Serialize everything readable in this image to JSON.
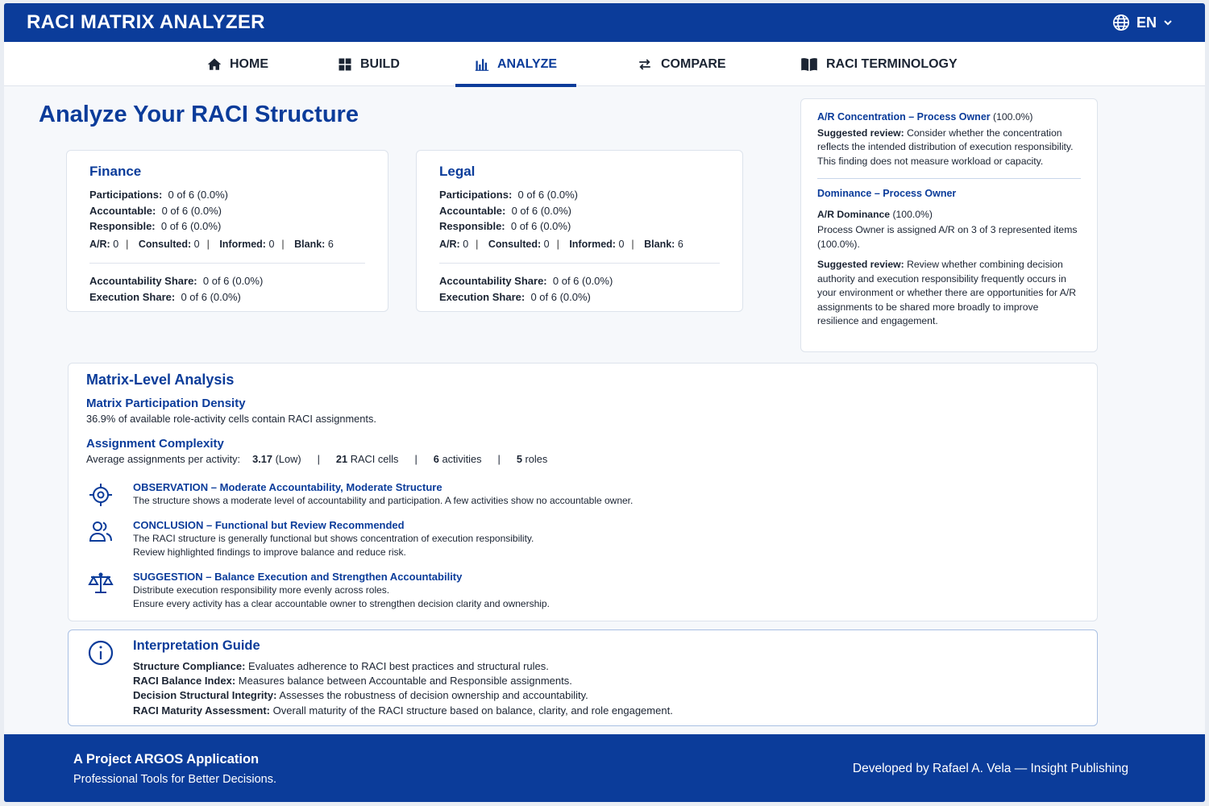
{
  "header": {
    "title": "RACI MATRIX ANALYZER",
    "language": "EN"
  },
  "nav": {
    "items": [
      {
        "label": "HOME",
        "icon": "home-icon"
      },
      {
        "label": "BUILD",
        "icon": "grid-icon"
      },
      {
        "label": "ANALYZE",
        "icon": "bar-chart-icon",
        "active": true
      },
      {
        "label": "COMPARE",
        "icon": "swap-arrows-icon"
      },
      {
        "label": "RACI TERMINOLOGY",
        "icon": "book-icon"
      }
    ]
  },
  "page": {
    "title": "Analyze Your RACI Structure"
  },
  "departments": [
    {
      "name": "Finance",
      "participations_label": "Participations:",
      "participations": "0 of 6 (0.0%)",
      "accountable_label": "Accountable:",
      "accountable": "0 of 6 (0.0%)",
      "responsible_label": "Responsible:",
      "responsible": "0 of 6 (0.0%)",
      "ar_label": "A/R:",
      "ar": "0",
      "consulted_label": "Consulted:",
      "consulted": "0",
      "informed_label": "Informed:",
      "informed": "0",
      "blank_label": "Blank:",
      "blank": "6",
      "acc_share_label": "Accountability Share:",
      "acc_share": "0 of 6 (0.0%)",
      "exec_share_label": "Execution Share:",
      "exec_share": "0 of 6 (0.0%)"
    },
    {
      "name": "Legal",
      "participations_label": "Participations:",
      "participations": "0 of 6 (0.0%)",
      "accountable_label": "Accountable:",
      "accountable": "0 of 6 (0.0%)",
      "responsible_label": "Responsible:",
      "responsible": "0 of 6 (0.0%)",
      "ar_label": "A/R:",
      "ar": "0",
      "consulted_label": "Consulted:",
      "consulted": "0",
      "informed_label": "Informed:",
      "informed": "0",
      "blank_label": "Blank:",
      "blank": "6",
      "acc_share_label": "Accountability Share:",
      "acc_share": "0 of 6 (0.0%)",
      "exec_share_label": "Execution Share:",
      "exec_share": "0 of 6 (0.0%)"
    }
  ],
  "side_panel": {
    "ar_concentration": {
      "heading": "A/R Concentration – Process Owner",
      "value": " (100.0%)",
      "review_label": "Suggested review:",
      "review_text": " Consider whether the concentration reflects the intended distribution of execution responsibility. This finding does not measure workload or capacity."
    },
    "dominance": {
      "heading": "Dominance – Process Owner",
      "ar_label": "A/R Dominance",
      "ar_value": " (100.0%)",
      "detail": "Process Owner is assigned A/R on 3 of 3 represented items (100.0%).",
      "review_label": "Suggested review:",
      "review_text": " Review whether combining decision authority and execution responsibility frequently occurs in your environment or whether there are opportunities for A/R assignments to be shared more broadly to improve resilience and engagement."
    }
  },
  "matrix": {
    "title": "Matrix-Level Analysis",
    "density_title": "Matrix Participation Density",
    "density_text": "36.9% of available role-activity cells contain RACI assignments.",
    "complexity_title": "Assignment Complexity",
    "complexity_label": "Average assignments per activity:",
    "avg_value": "3.17",
    "avg_level": " (Low)",
    "cells_value": "21",
    "cells_label": " RACI cells",
    "activities_value": "6",
    "activities_label": " activities",
    "roles_value": "5",
    "roles_label": " roles",
    "findings": [
      {
        "icon": "target-icon",
        "title": "OBSERVATION – Moderate Accountability, Moderate Structure",
        "lines": [
          "The structure shows a moderate level of accountability and participation. A few activities show no accountable owner."
        ]
      },
      {
        "icon": "users-icon",
        "title": "CONCLUSION – Functional but Review Recommended",
        "lines": [
          "The RACI structure is generally functional but shows concentration of execution responsibility.",
          "Review highlighted findings to improve balance and reduce risk."
        ]
      },
      {
        "icon": "scale-icon",
        "title": "SUGGESTION – Balance Execution and Strengthen Accountability",
        "lines": [
          "Distribute execution responsibility more evenly across roles.",
          "Ensure every activity has a clear accountable owner to strengthen decision clarity and ownership."
        ]
      }
    ]
  },
  "guide": {
    "title": "Interpretation Guide",
    "items": [
      {
        "term": "Structure Compliance:",
        "desc": " Evaluates adherence to RACI best practices and structural rules."
      },
      {
        "term": "RACI Balance Index:",
        "desc": " Measures balance between Accountable and Responsible assignments."
      },
      {
        "term": "Decision Structural Integrity:",
        "desc": " Assesses the robustness of decision ownership and accountability."
      },
      {
        "term": "RACI Maturity Assessment:",
        "desc": " Overall maturity of the RACI structure based on balance, clarity, and role engagement."
      }
    ]
  },
  "footer": {
    "title": "A Project ARGOS Application",
    "tagline": "Professional Tools for Better Decisions.",
    "credit": "Developed by Rafael A. Vela — Insight Publishing"
  },
  "colors": {
    "brand": "#0b3c9a",
    "background": "#f6f8fb"
  }
}
